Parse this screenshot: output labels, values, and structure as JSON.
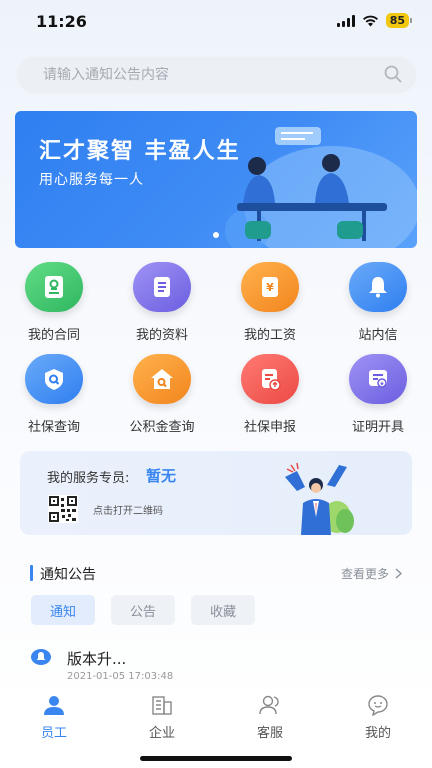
{
  "status": {
    "time": "11:26",
    "battery": "85"
  },
  "search": {
    "placeholder": "请输入通知公告内容"
  },
  "banner": {
    "title": "汇才聚智 丰盈人生",
    "subtitle": "用心服务每一人"
  },
  "grid": [
    {
      "label": "我的合同",
      "icon": "contract-icon",
      "color": "#35c26b"
    },
    {
      "label": "我的资料",
      "icon": "profile-doc-icon",
      "color": "#7c6fe6"
    },
    {
      "label": "我的工资",
      "icon": "salary-icon",
      "color": "#f5902a"
    },
    {
      "label": "站内信",
      "icon": "bell-icon",
      "color": "#3a86f0"
    },
    {
      "label": "社保查询",
      "icon": "social-security-search-icon",
      "color": "#3a86f0"
    },
    {
      "label": "公积金查询",
      "icon": "housing-fund-search-icon",
      "color": "#f5902a"
    },
    {
      "label": "社保申报",
      "icon": "social-security-declare-icon",
      "color": "#f0544f"
    },
    {
      "label": "证明开具",
      "icon": "certificate-icon",
      "color": "#7c6fe6"
    }
  ],
  "service": {
    "label": "我的服务专员:",
    "value": "暂无",
    "qr_hint": "点击打开二维码"
  },
  "notice": {
    "title": "通知公告",
    "more": "查看更多",
    "tabs": [
      "通知",
      "公告",
      "收藏"
    ],
    "active_tab": 0,
    "items": [
      {
        "title": "版本升...",
        "time": "2021-01-05 17:03:48"
      }
    ]
  },
  "nav": [
    {
      "label": "员工",
      "icon": "person-icon",
      "active": true
    },
    {
      "label": "企业",
      "icon": "building-icon",
      "active": false
    },
    {
      "label": "客服",
      "icon": "customer-service-icon",
      "active": false
    },
    {
      "label": "我的",
      "icon": "profile-icon",
      "active": false
    }
  ],
  "colors": {
    "accent": "#3a86f0",
    "banner": "#2f7ff1"
  }
}
